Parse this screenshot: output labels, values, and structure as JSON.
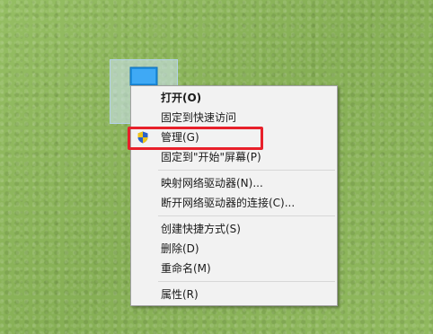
{
  "desktop_icon": {
    "icon": "this-pc-icon"
  },
  "context_menu": {
    "items": [
      {
        "label": "打开(O)",
        "bold": true
      },
      {
        "label": "固定到快速访问"
      },
      {
        "label": "管理(G)",
        "icon": "uac-shield-icon"
      },
      {
        "label": "固定到\"开始\"屏幕(P)"
      },
      {
        "label": "映射网络驱动器(N)..."
      },
      {
        "label": "断开网络驱动器的连接(C)..."
      },
      {
        "label": "创建快捷方式(S)"
      },
      {
        "label": "删除(D)"
      },
      {
        "label": "重命名(M)"
      },
      {
        "label": "属性(R)"
      }
    ]
  },
  "annotation": {
    "highlight_color": "#e8202a",
    "target_item": "管理(G)"
  },
  "colors": {
    "desktop_background": "#8db65c",
    "menu_background": "#f2f2f2",
    "menu_border": "#a0a0a0"
  }
}
